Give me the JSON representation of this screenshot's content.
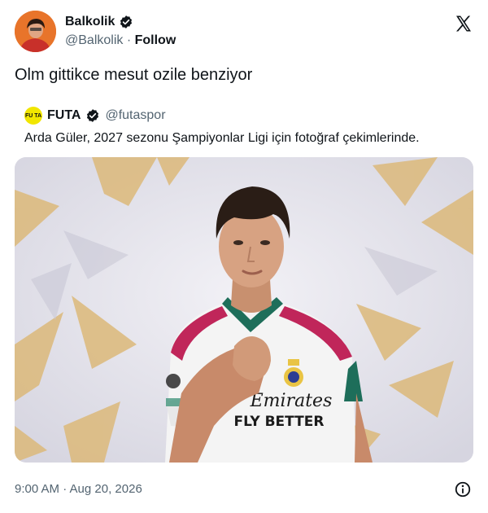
{
  "author": {
    "display_name": "Balkolik",
    "handle": "@Balkolik",
    "separator": "·",
    "follow_label": "Follow"
  },
  "tweet": {
    "text": "Olm gittikce mesut ozile benziyor",
    "timestamp": "9:00 AM · Aug 20, 2026"
  },
  "quoted": {
    "avatar_text": "FU TA",
    "name": "FUTA",
    "handle": "@futaspor",
    "text": "Arda Güler, 2027 sezonu Şampiyonlar Ligi için fotoğraf çekimlerinde.",
    "photo": {
      "shirt_sponsor_line1": "Emirates",
      "shirt_sponsor_line2": "FLY BETTER"
    }
  },
  "icons": {
    "verified": "verified-badge-icon",
    "brand": "x-logo-icon",
    "info": "info-icon"
  },
  "colors": {
    "text_primary": "#0f1419",
    "text_secondary": "#536471",
    "avatar_bg": "#e8742a",
    "quote_avatar_bg": "#f1e600"
  }
}
